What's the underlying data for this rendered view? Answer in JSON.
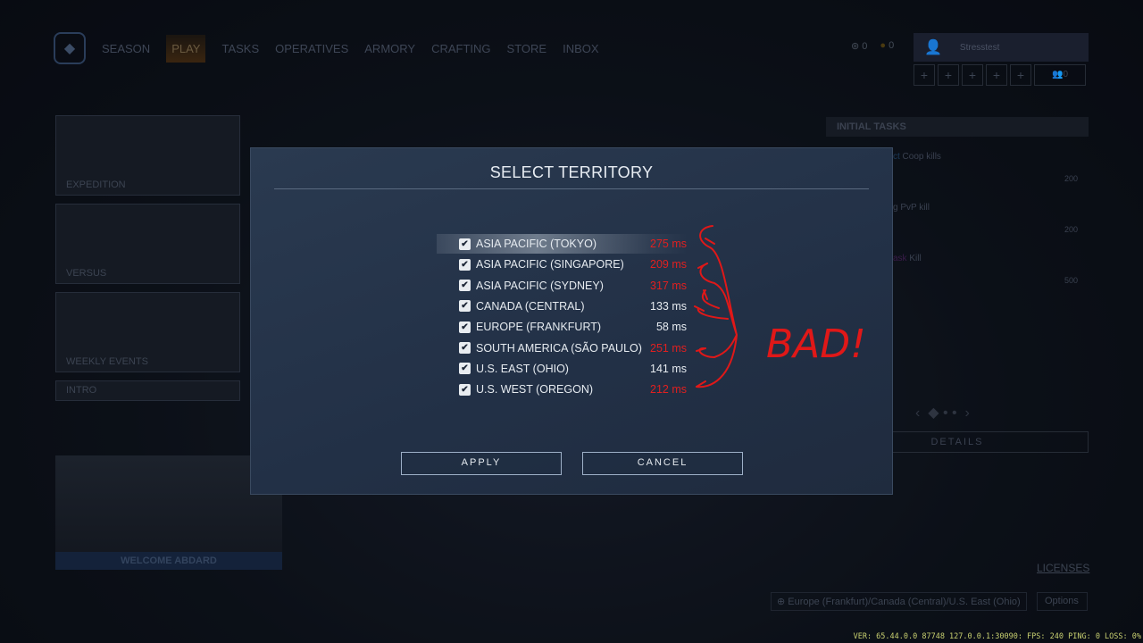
{
  "nav": {
    "items": [
      "SEASON",
      "PLAY",
      "TASKS",
      "OPERATIVES",
      "ARMORY",
      "CRAFTING",
      "STORE",
      "INBOX"
    ],
    "active": "PLAY"
  },
  "currency": {
    "credits": "0",
    "gold": "0"
  },
  "user": {
    "name": "Stresstest",
    "party_count": "0",
    "slot_label": "+"
  },
  "tasks": {
    "title": "INITIAL TASKS",
    "items": [
      {
        "text": "ct",
        "rest": " Coop kills",
        "reward": "200"
      },
      {
        "text": "g PvP kill",
        "rest": "",
        "reward": "200"
      },
      {
        "text": "ask",
        "rest": " Kill",
        "reward": "500"
      }
    ],
    "details": "DETAILS"
  },
  "modes": [
    "EXPEDITION",
    "VERSUS",
    "WEEKLY EVENTS",
    "INTRO"
  ],
  "welcome": "WELCOME ABDARD",
  "dialog": {
    "title": "SELECT TERRITORY",
    "apply": "APPLY",
    "cancel": "CANCEL",
    "regions": [
      {
        "name": "ASIA PACIFIC (TOKYO)",
        "ping": "275 ms",
        "bad": true,
        "checked": true
      },
      {
        "name": "ASIA PACIFIC (SINGAPORE)",
        "ping": "209 ms",
        "bad": true,
        "checked": true
      },
      {
        "name": "ASIA PACIFIC (SYDNEY)",
        "ping": "317 ms",
        "bad": true,
        "checked": true
      },
      {
        "name": "CANADA (CENTRAL)",
        "ping": "133 ms",
        "bad": false,
        "checked": true
      },
      {
        "name": "EUROPE (FRANKFURT)",
        "ping": "58 ms",
        "bad": false,
        "checked": true
      },
      {
        "name": "SOUTH AMERICA (SÃO PAULO)",
        "ping": "251 ms",
        "bad": true,
        "checked": true
      },
      {
        "name": "U.S. EAST (OHIO)",
        "ping": "141 ms",
        "bad": false,
        "checked": true
      },
      {
        "name": "U.S. WEST (OREGON)",
        "ping": "212 ms",
        "bad": true,
        "checked": true
      }
    ]
  },
  "annotation": "BAD!",
  "footer": {
    "licenses": "LICENSES",
    "territory": "Europe (Frankfurt)/Canada (Central)/U.S. East (Ohio)",
    "options": "Options"
  },
  "version": "VER: 65.44.0.0 87748 127.0.0.1:30090:  FPS: 240 PING: 0 LOSS: 0%",
  "colors": {
    "bad_ping": "#e02020",
    "good_ping": "#e6ebf0",
    "annotation": "#e01818"
  }
}
